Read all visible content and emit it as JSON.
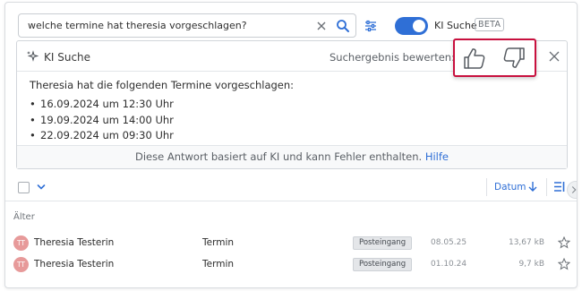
{
  "search": {
    "query": "welche termine hat theresia vorgeschlagen?",
    "toggle_label": "KI Suche",
    "beta_badge": "BETA"
  },
  "ai_panel": {
    "title": "KI Suche",
    "rate_label": "Suchergebnis bewerten:",
    "intro": "Theresia hat die folgenden Termine vorgeschlagen:",
    "items": [
      "16.09.2024 um 12:30 Uhr",
      "19.09.2024 um 14:00 Uhr",
      "22.09.2024 um 09:30 Uhr"
    ],
    "disclaimer": "Diese Antwort basiert auf KI und kann Fehler enthalten.",
    "help_link": "Hilfe"
  },
  "list": {
    "sort_label": "Datum",
    "group_label": "Älter",
    "rows": [
      {
        "initials": "TT",
        "sender": "Theresia Testerin",
        "subject": "Termin",
        "folder": "Posteingang",
        "date": "08.05.25",
        "size": "13,67 kB"
      },
      {
        "initials": "TT",
        "sender": "Theresia Testerin",
        "subject": "Termin",
        "folder": "Posteingang",
        "date": "01.10.24",
        "size": "9,7 kB"
      }
    ]
  },
  "colors": {
    "accent": "#2f6fd6",
    "highlight_border": "#c8103e",
    "avatar": "#e79a9a"
  }
}
